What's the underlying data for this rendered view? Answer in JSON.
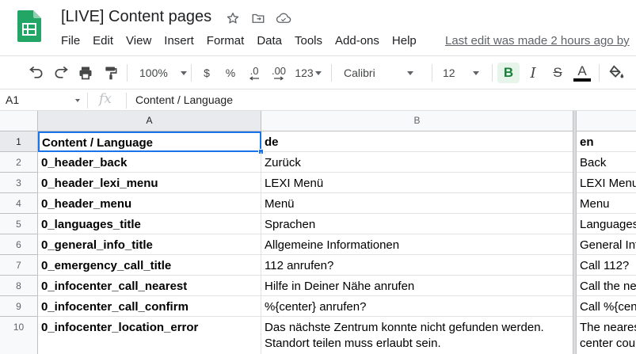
{
  "document": {
    "title": "[LIVE] Content pages",
    "last_edit": "Last edit was made 2 hours ago by"
  },
  "menu": [
    "File",
    "Edit",
    "View",
    "Insert",
    "Format",
    "Data",
    "Tools",
    "Add-ons",
    "Help"
  ],
  "toolbar": {
    "zoom": "100%",
    "currency": "$",
    "percent": "%",
    "decrease_decimals": ".0",
    "increase_decimals": ".00",
    "more_formats": "123",
    "font": "Calibri",
    "font_size": "12",
    "bold": "B",
    "italic": "I",
    "strikethrough": "S",
    "text_color": "A",
    "text_color_value": "#000000"
  },
  "formula_bar": {
    "cell_ref": "A1",
    "fx": "fx",
    "value": "Content / Language"
  },
  "grid": {
    "columns": [
      "A",
      "B"
    ],
    "rows": [
      {
        "num": "1",
        "a": "Content / Language",
        "b": "de",
        "c": "en"
      },
      {
        "num": "2",
        "a": "0_header_back",
        "b": "Zurück",
        "c": "Back"
      },
      {
        "num": "3",
        "a": "0_header_lexi_menu",
        "b": "LEXI Menü",
        "c": "LEXI Menu"
      },
      {
        "num": "4",
        "a": "0_header_menu",
        "b": "Menü",
        "c": "Menu"
      },
      {
        "num": "5",
        "a": "0_languages_title",
        "b": "Sprachen",
        "c": "Languages"
      },
      {
        "num": "6",
        "a": "0_general_info_title",
        "b": "Allgemeine Informationen",
        "c": "General Information"
      },
      {
        "num": "7",
        "a": "0_emergency_call_title",
        "b": "112 anrufen?",
        "c": "Call 112?"
      },
      {
        "num": "8",
        "a": "0_infocenter_call_nearest",
        "b": "Hilfe in Deiner Nähe anrufen",
        "c": "Call the nearest"
      },
      {
        "num": "9",
        "a": "0_infocenter_call_confirm",
        "b": "%{center} anrufen?",
        "c": "Call %{center}?"
      },
      {
        "num": "10",
        "a": "0_infocenter_location_error",
        "b": "Das nächste Zentrum konnte nicht gefunden werden. Standort teilen muss erlaubt sein.",
        "c": "The nearest center could not be found. Location sharing must be enabled for this."
      }
    ]
  },
  "colors": {
    "accent": "#1a73e8",
    "sheets_green": "#0f9d58",
    "bold_active_bg": "#e6f4ea"
  }
}
